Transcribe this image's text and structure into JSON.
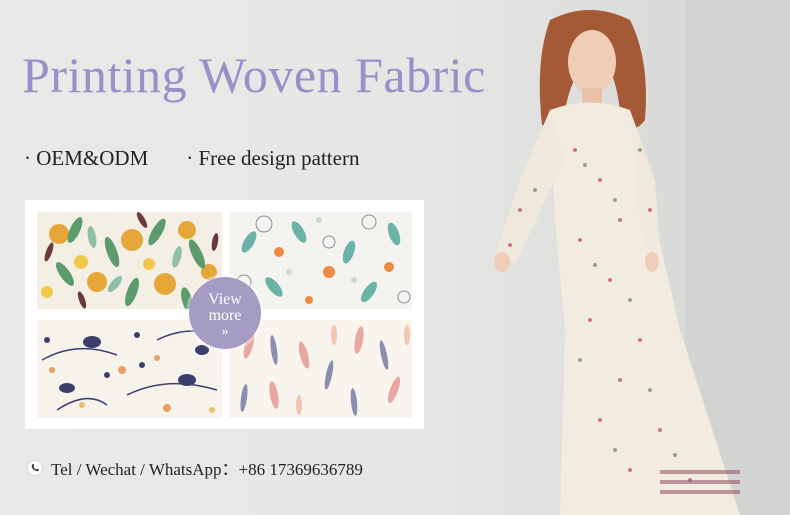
{
  "banner": {
    "headline": "Printing Woven Fabric",
    "bullets": [
      "· OEM&ODM",
      "· Free design pattern"
    ],
    "view_more": {
      "line1": "View",
      "line2": "more",
      "chevron": "»"
    },
    "contact": "Tel / Wechat / WhatsApp：+86 17369636789",
    "icons": {
      "contact": "phone-icon"
    },
    "colors": {
      "accent": "#9a8fc8",
      "badge": "#a49cc2",
      "text": "#222222",
      "background": "#e8e8e6"
    }
  },
  "swatches": [
    {
      "name": "orange-tulip-leaf-print"
    },
    {
      "name": "teal-dandelion-print"
    },
    {
      "name": "navy-bird-branch-print"
    },
    {
      "name": "pink-grey-leaf-print"
    }
  ]
}
